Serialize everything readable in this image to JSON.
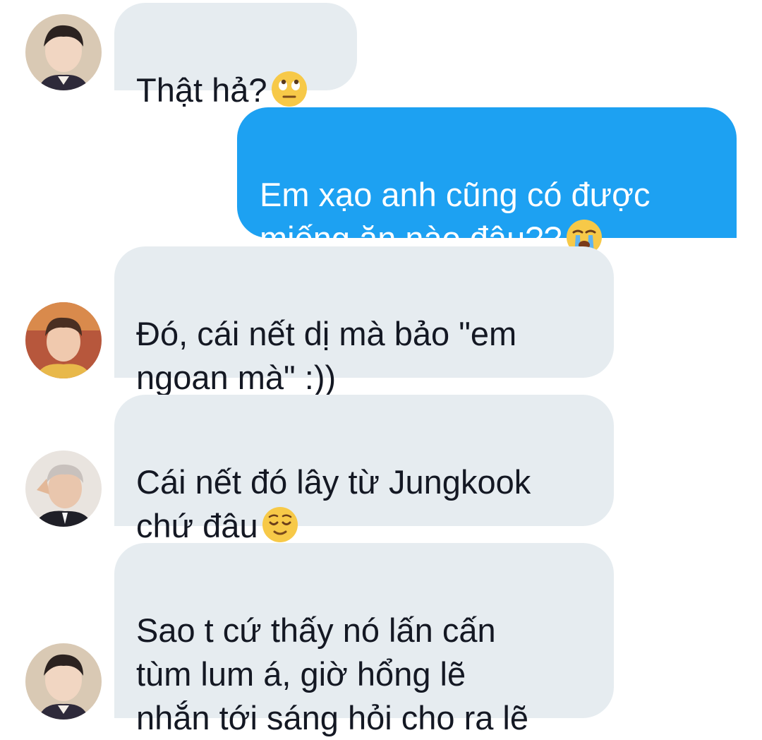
{
  "messages": [
    {
      "side": "in",
      "text": "Thật hả?",
      "emoji": "eye-roll-emoji"
    },
    {
      "side": "out",
      "text": "Em xạo anh cũng có được\nmiếng ăn nào đâu??",
      "emoji": "loudly-crying-emoji"
    },
    {
      "side": "in",
      "text": "Đó, cái nết dị mà bảo \"em\nngoan mà\" :))"
    },
    {
      "side": "in",
      "text": "Cái nết đó lây từ Jungkook\nchứ đâu",
      "emoji": "relieved-emoji"
    },
    {
      "side": "in",
      "text": "Sao t cứ thấy nó lấn cấn\ntùm lum á, giờ hổng lẽ\nnhắn tới sáng hỏi cho ra lẽ"
    }
  ],
  "colors": {
    "incoming_bubble": "#e6ecf0",
    "outgoing_bubble": "#1da1f2",
    "incoming_text": "#141823",
    "outgoing_text": "#ffffff"
  }
}
